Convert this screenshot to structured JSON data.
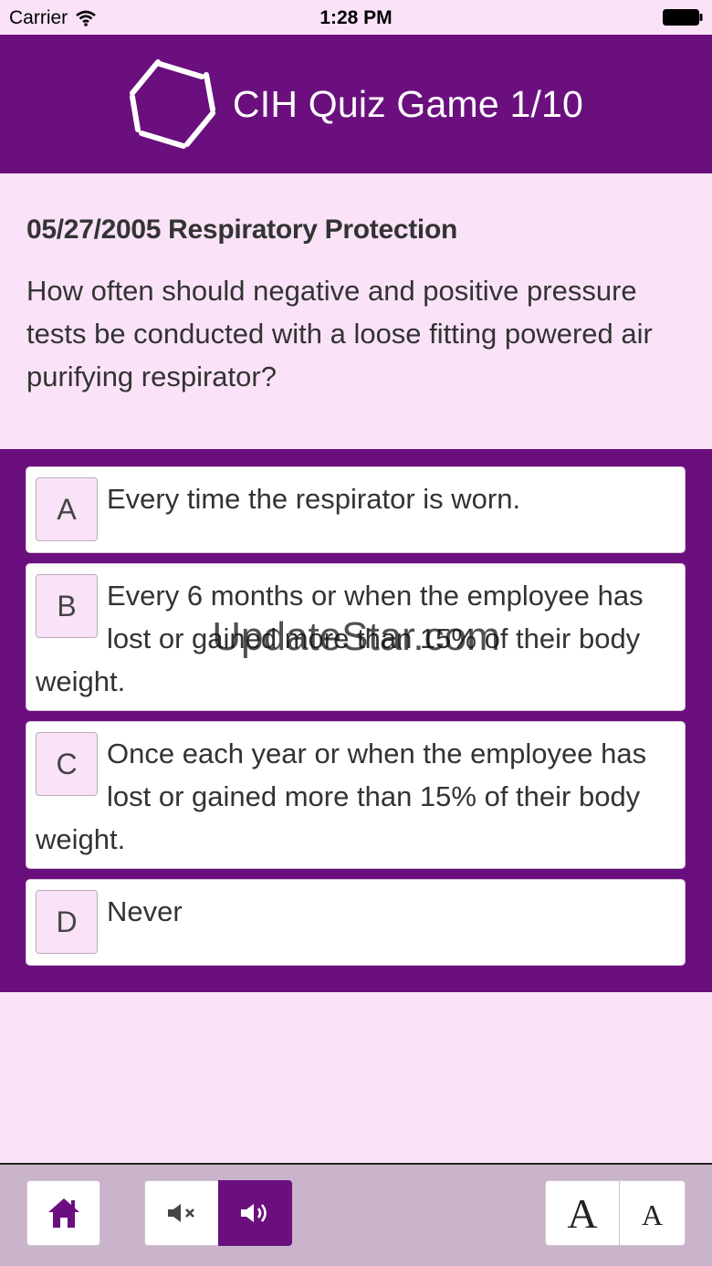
{
  "status_bar": {
    "carrier": "Carrier",
    "time": "1:28 PM"
  },
  "header": {
    "title": "CIH Quiz Game 1/10",
    "logo_icon": "hexagon-logo-icon"
  },
  "question": {
    "title": "05/27/2005 Respiratory Protection",
    "text": "How often should negative and positive pressure tests be conducted with a loose fitting powered air purifying respirator?"
  },
  "answers": [
    {
      "letter": "A",
      "text": "Every time the respirator is worn."
    },
    {
      "letter": "B",
      "text": "Every 6 months or when the employee has lost or gained more than 15% of their body weight."
    },
    {
      "letter": "C",
      "text": "Once each year or when the employee has lost or gained more than 15% of their body weight."
    },
    {
      "letter": "D",
      "text": "Never"
    }
  ],
  "watermark": "UpdateStar.com",
  "toolbar": {
    "home_icon": "home-icon",
    "mute_icon": "speaker-mute-icon",
    "volume_icon": "speaker-on-icon",
    "font_large_label": "A",
    "font_small_label": "A"
  },
  "colors": {
    "accent": "#6b0f7e",
    "background": "#fae3f8",
    "toolbar": "#c9b4cb"
  }
}
